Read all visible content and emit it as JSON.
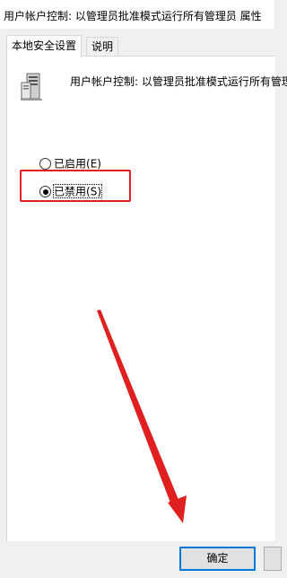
{
  "window": {
    "title": "用户帐户控制: 以管理员批准模式运行所有管理员 属性"
  },
  "tabs": [
    {
      "label": "本地安全设置",
      "active": true
    },
    {
      "label": "说明",
      "active": false
    }
  ],
  "policy": {
    "icon": "server-icon",
    "name": "用户帐户控制: 以管理员批准模式运行所有管理"
  },
  "options": [
    {
      "label": "已启用",
      "mnemonic": "(E)",
      "selected": false
    },
    {
      "label": "已禁用",
      "mnemonic": "(S)",
      "selected": true
    }
  ],
  "buttons": {
    "ok_label": "确定"
  },
  "annotation": {
    "highlight_color": "#e02020",
    "arrow_color": "#e02020"
  }
}
